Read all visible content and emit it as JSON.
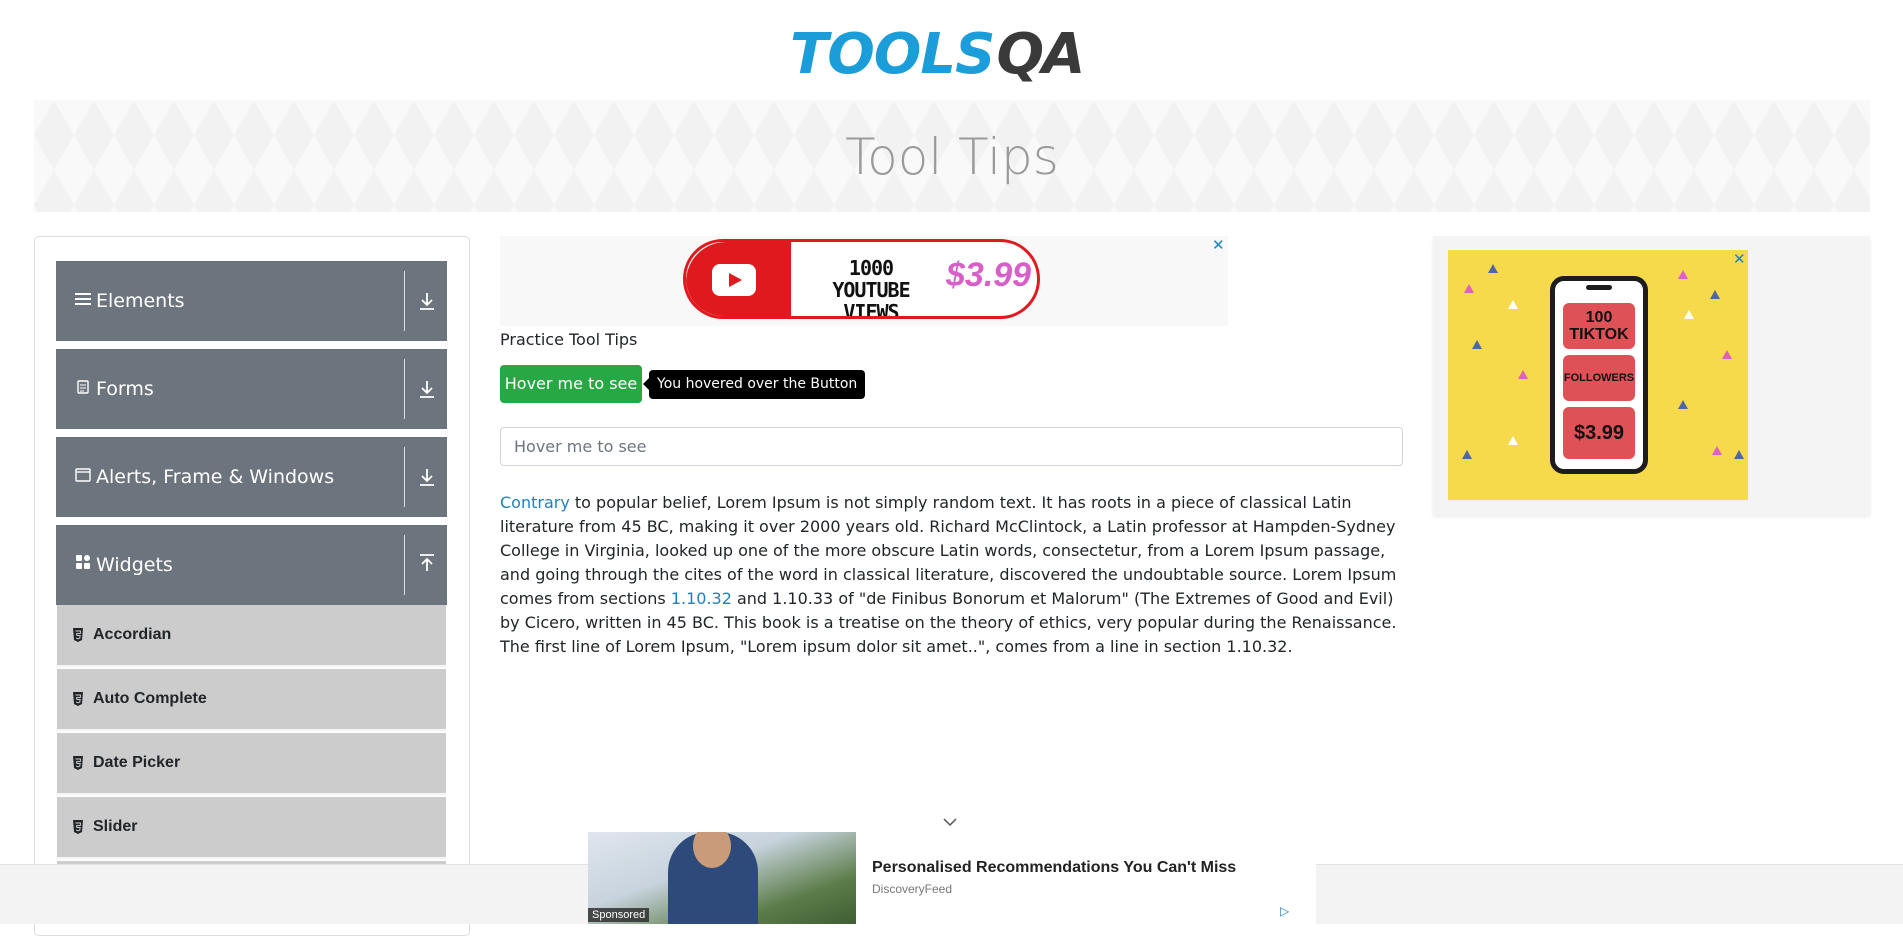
{
  "header": {
    "logo_tools": "TOOLS",
    "logo_qa": "QA"
  },
  "banner": {
    "title": "Tool Tips"
  },
  "sidebar": {
    "groups": [
      {
        "label": "Elements",
        "icon": "hamburger-icon",
        "arrow": "download-icon"
      },
      {
        "label": "Forms",
        "icon": "document-icon",
        "arrow": "download-icon"
      },
      {
        "label": "Alerts, Frame & Windows",
        "icon": "window-icon",
        "arrow": "download-icon"
      },
      {
        "label": "Widgets",
        "icon": "widgets-icon",
        "arrow": "upload-icon"
      }
    ],
    "items": [
      {
        "label": "Accordian"
      },
      {
        "label": "Auto Complete"
      },
      {
        "label": "Date Picker"
      },
      {
        "label": "Slider"
      }
    ]
  },
  "top_ad": {
    "text_line1": "1000",
    "text_line2": "YOUTUBE VIEWS",
    "price": "$3.99",
    "close": "✕"
  },
  "main": {
    "practice_label": "Practice Tool Tips",
    "hover_button": "Hover me to see",
    "tooltip": "You hovered over the Button",
    "hover_field_placeholder": "Hover me to see",
    "para": {
      "link1": "Contrary",
      "text1": " to popular belief, Lorem Ipsum is not simply random text. It has roots in a piece of classical Latin literature from 45 BC, making it over 2000 years old. Richard McClintock, a Latin professor at Hampden-Sydney College in Virginia, looked up one of the more obscure Latin words, consectetur, from a Lorem Ipsum passage, and going through the cites of the word in classical literature, discovered the undoubtable source. Lorem Ipsum comes from sections ",
      "link2": "1.10.32",
      "text2": " and 1.10.33 of \"de Finibus Bonorum et Malorum\" (The Extremes of Good and Evil) by Cicero, written in 45 BC. This book is a treatise on the theory of ethics, very popular during the Renaissance. The first line of Lorem Ipsum, \"Lorem ipsum dolor sit amet..\", comes from a line in section 1.10.32."
    }
  },
  "right_ad": {
    "box1": "100\nTIKTOK",
    "box2": "FOLLOWERS",
    "box3": "$3.99",
    "close": "✕"
  },
  "bottom_ad": {
    "title": "Personalised Recommendations You Can't Miss",
    "source": "DiscoveryFeed",
    "sponsored": "Sponsored",
    "adchoices": "▷"
  },
  "colors": {
    "accent": "#1b9dd9",
    "sidebar_group": "#6c757d",
    "sidebar_item": "#cccccc",
    "button": "#28a745",
    "link": "#1d80c3"
  }
}
